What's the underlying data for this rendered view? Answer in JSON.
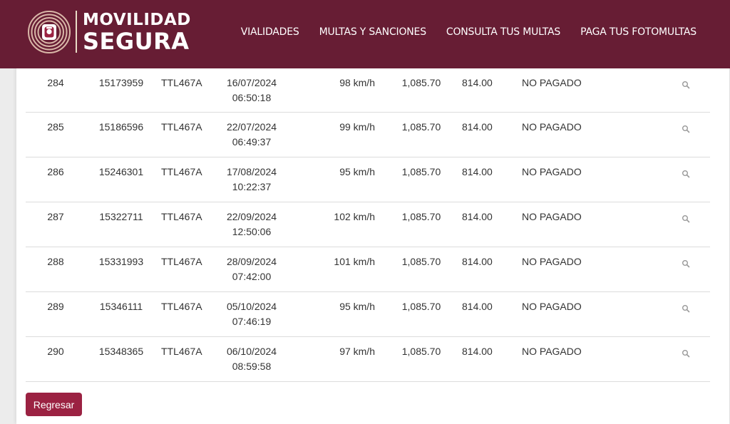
{
  "brand": {
    "line1": "MOVILIDAD",
    "line2": "SEGURA"
  },
  "nav": [
    {
      "label": "VIALIDADES"
    },
    {
      "label": "MULTAS Y SANCIONES"
    },
    {
      "label": "CONSULTA TUS MULTAS"
    },
    {
      "label": "PAGA TUS FOTOMULTAS"
    }
  ],
  "rows": [
    {
      "num": "284",
      "folio": "15173959",
      "placa": "TTL467A",
      "fecha": "16/07/2024",
      "hora": "06:50:18",
      "velocidad": "98 km/h",
      "monto": "1,085.70",
      "descuento": "814.00",
      "estado": "NO PAGADO"
    },
    {
      "num": "285",
      "folio": "15186596",
      "placa": "TTL467A",
      "fecha": "22/07/2024",
      "hora": "06:49:37",
      "velocidad": "99 km/h",
      "monto": "1,085.70",
      "descuento": "814.00",
      "estado": "NO PAGADO"
    },
    {
      "num": "286",
      "folio": "15246301",
      "placa": "TTL467A",
      "fecha": "17/08/2024",
      "hora": "10:22:37",
      "velocidad": "95 km/h",
      "monto": "1,085.70",
      "descuento": "814.00",
      "estado": "NO PAGADO"
    },
    {
      "num": "287",
      "folio": "15322711",
      "placa": "TTL467A",
      "fecha": "22/09/2024",
      "hora": "12:50:06",
      "velocidad": "102 km/h",
      "monto": "1,085.70",
      "descuento": "814.00",
      "estado": "NO PAGADO"
    },
    {
      "num": "288",
      "folio": "15331993",
      "placa": "TTL467A",
      "fecha": "28/09/2024",
      "hora": "07:42:00",
      "velocidad": "101 km/h",
      "monto": "1,085.70",
      "descuento": "814.00",
      "estado": "NO PAGADO"
    },
    {
      "num": "289",
      "folio": "15346111",
      "placa": "TTL467A",
      "fecha": "05/10/2024",
      "hora": "07:46:19",
      "velocidad": "95 km/h",
      "monto": "1,085.70",
      "descuento": "814.00",
      "estado": "NO PAGADO"
    },
    {
      "num": "290",
      "folio": "15348365",
      "placa": "TTL467A",
      "fecha": "06/10/2024",
      "hora": "08:59:58",
      "velocidad": "97 km/h",
      "monto": "1,085.70",
      "descuento": "814.00",
      "estado": "NO PAGADO"
    }
  ],
  "row_icon": "search-icon",
  "back_button": {
    "label": "Regresar"
  },
  "colors": {
    "header": "#671d34",
    "button": "#9b2242",
    "logo_ring": "#e9dcc6"
  }
}
